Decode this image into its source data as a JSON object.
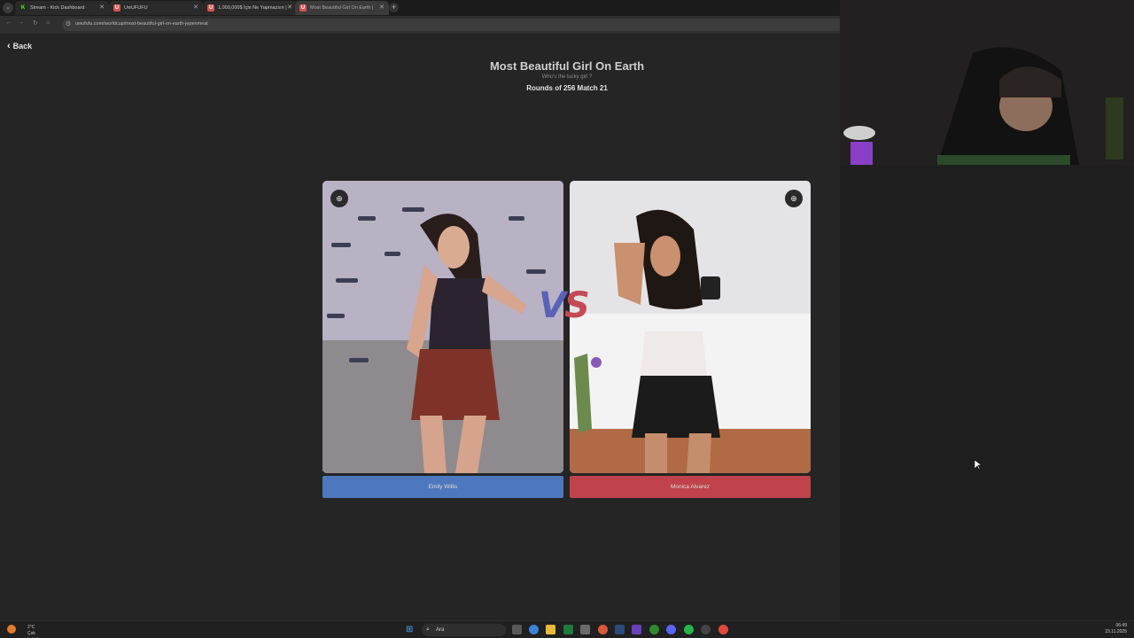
{
  "browser": {
    "tabs": [
      {
        "label": "Stream - Kick Dashboard",
        "favicon": "K",
        "favicon_color": "#53fc18"
      },
      {
        "label": "UwUFUFU",
        "favicon": "U",
        "favicon_color": "#d9534f"
      },
      {
        "label": "1,000,000$ İçin Ne Yapmazsın |",
        "favicon": "U",
        "favicon_color": "#d9534f"
      },
      {
        "label": "Most Beautiful Girl On Earth |",
        "favicon": "U",
        "favicon_color": "#d9534f"
      }
    ],
    "url": "uwufufu.com/worldcup/most-beautiful-girl-on-earth-jepenmeat"
  },
  "page": {
    "back_label": "Back",
    "title": "Most Beautiful Girl On Earth",
    "subtitle": "Who's the lucky girl ?",
    "round_info": "Rounds of 256 Match 21",
    "vs_v": "V",
    "vs_s": "S",
    "left": {
      "name": "Emily Willis"
    },
    "right": {
      "name": "Monica Alvarez"
    }
  },
  "taskbar": {
    "weather_temp": "2°C",
    "weather_desc": "Çok bulutlu",
    "search_placeholder": "Ara",
    "time": "06:49",
    "date": "23.11.2025"
  },
  "colors": {
    "left_button": "#4e78bd",
    "right_button": "#c0424a",
    "vs_v": "#5a62b8",
    "vs_s": "#c44a55"
  }
}
